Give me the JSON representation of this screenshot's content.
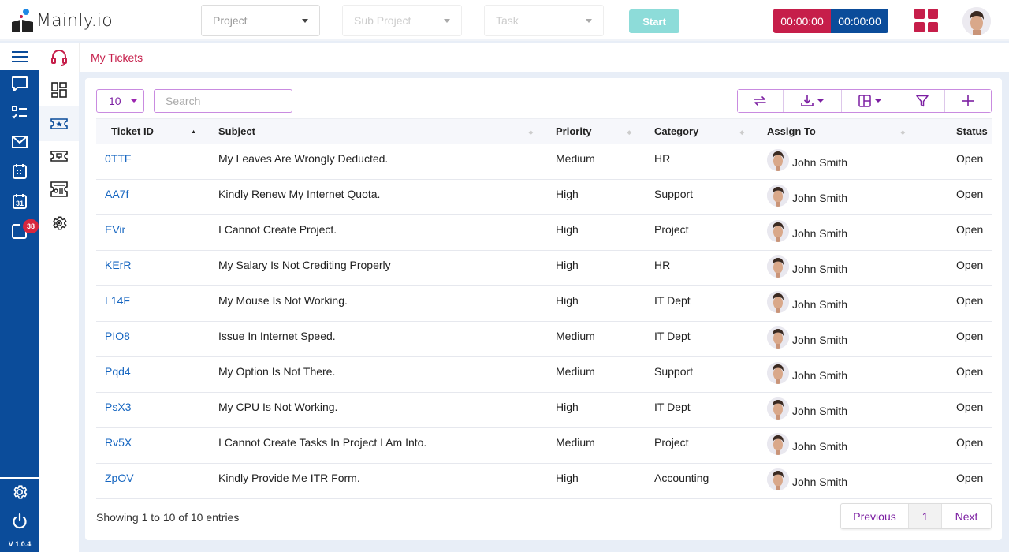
{
  "app": {
    "brand": "Mainly.io",
    "version": "V 1.0.4"
  },
  "header": {
    "project_select": {
      "placeholder": "Project"
    },
    "subproject_select": {
      "placeholder": "Sub Project"
    },
    "task_select": {
      "placeholder": "Task"
    },
    "start_label": "Start",
    "timer_primary": "00:00:00",
    "timer_secondary": "00:00:00",
    "colors": {
      "timer_primary": "#c61e4a",
      "timer_secondary": "#0b4c9a",
      "start": "#8ddcd9"
    }
  },
  "rail": {
    "items": [
      {
        "icon": "menu-icon"
      },
      {
        "icon": "chat-icon"
      },
      {
        "icon": "checklist-icon"
      },
      {
        "icon": "mail-icon"
      },
      {
        "icon": "calendar-icon"
      },
      {
        "icon": "calendar-31-icon"
      },
      {
        "icon": "notification-icon",
        "badge": "38"
      }
    ],
    "bottom": [
      {
        "icon": "settings-icon"
      },
      {
        "icon": "power-icon"
      }
    ]
  },
  "subbar": {
    "items": [
      {
        "icon": "headset-icon"
      },
      {
        "icon": "dashboard-icon"
      },
      {
        "icon": "ticket-star-icon",
        "active": true
      },
      {
        "icon": "ticket-icon"
      },
      {
        "icon": "ticket-report-icon"
      },
      {
        "icon": "gear-icon"
      }
    ]
  },
  "breadcrumb": "My Tickets",
  "table_controls": {
    "page_length": "10",
    "search_placeholder": "Search",
    "toolbar": [
      "refresh-icon",
      "download-icon",
      "columns-icon",
      "filter-icon",
      "add-icon"
    ]
  },
  "table": {
    "columns": [
      "Ticket ID",
      "Subject",
      "Priority",
      "Category",
      "Assign To",
      "Status"
    ],
    "rows": [
      {
        "id": "0TTF",
        "subject": "My Leaves Are Wrongly Deducted.",
        "priority": "Medium",
        "category": "HR",
        "assignee": "John Smith",
        "status": "Open"
      },
      {
        "id": "AA7f",
        "subject": "Kindly Renew My Internet Quota.",
        "priority": "High",
        "category": "Support",
        "assignee": "John Smith",
        "status": "Open"
      },
      {
        "id": "EVir",
        "subject": "I Cannot Create Project.",
        "priority": "High",
        "category": "Project",
        "assignee": "John Smith",
        "status": "Open"
      },
      {
        "id": "KErR",
        "subject": "My Salary Is Not Crediting Properly",
        "priority": "High",
        "category": "HR",
        "assignee": "John Smith",
        "status": "Open"
      },
      {
        "id": "L14F",
        "subject": "My Mouse Is Not Working.",
        "priority": "High",
        "category": "IT Dept",
        "assignee": "John Smith",
        "status": "Open"
      },
      {
        "id": "PIO8",
        "subject": "Issue In Internet Speed.",
        "priority": "Medium",
        "category": "IT Dept",
        "assignee": "John Smith",
        "status": "Open"
      },
      {
        "id": "Pqd4",
        "subject": "My Option Is Not There.",
        "priority": "Medium",
        "category": "Support",
        "assignee": "John Smith",
        "status": "Open"
      },
      {
        "id": "PsX3",
        "subject": "My CPU Is Not Working.",
        "priority": "High",
        "category": "IT Dept",
        "assignee": "John Smith",
        "status": "Open"
      },
      {
        "id": "Rv5X",
        "subject": "I Cannot Create Tasks In Project I Am Into.",
        "priority": "Medium",
        "category": "Project",
        "assignee": "John Smith",
        "status": "Open"
      },
      {
        "id": "ZpOV",
        "subject": "Kindly Provide Me ITR Form.",
        "priority": "High",
        "category": "Accounting",
        "assignee": "John Smith",
        "status": "Open"
      }
    ]
  },
  "footer": {
    "info": "Showing 1 to 10 of 10 entries",
    "previous": "Previous",
    "current_page": "1",
    "next": "Next"
  }
}
